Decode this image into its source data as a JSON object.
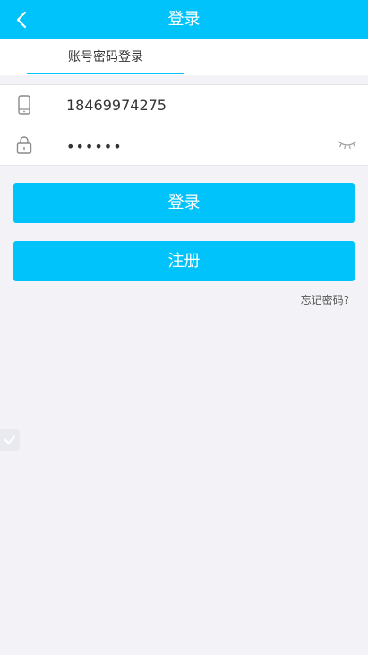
{
  "header": {
    "title": "登录",
    "back_icon": "chevron-left-icon"
  },
  "tabs": [
    {
      "label": "账号密码登录",
      "active": true
    }
  ],
  "form": {
    "phone": {
      "icon": "phone-icon",
      "value": "18469974275"
    },
    "password": {
      "icon": "lock-icon",
      "masked_value": "••••••",
      "toggle_icon": "eye-closed-icon"
    }
  },
  "buttons": {
    "login_label": "登录",
    "register_label": "注册"
  },
  "links": {
    "forgot_label": "忘记密码?"
  },
  "colors": {
    "accent": "#00c3fb",
    "background": "#f3f3f7",
    "text": "#333333"
  }
}
